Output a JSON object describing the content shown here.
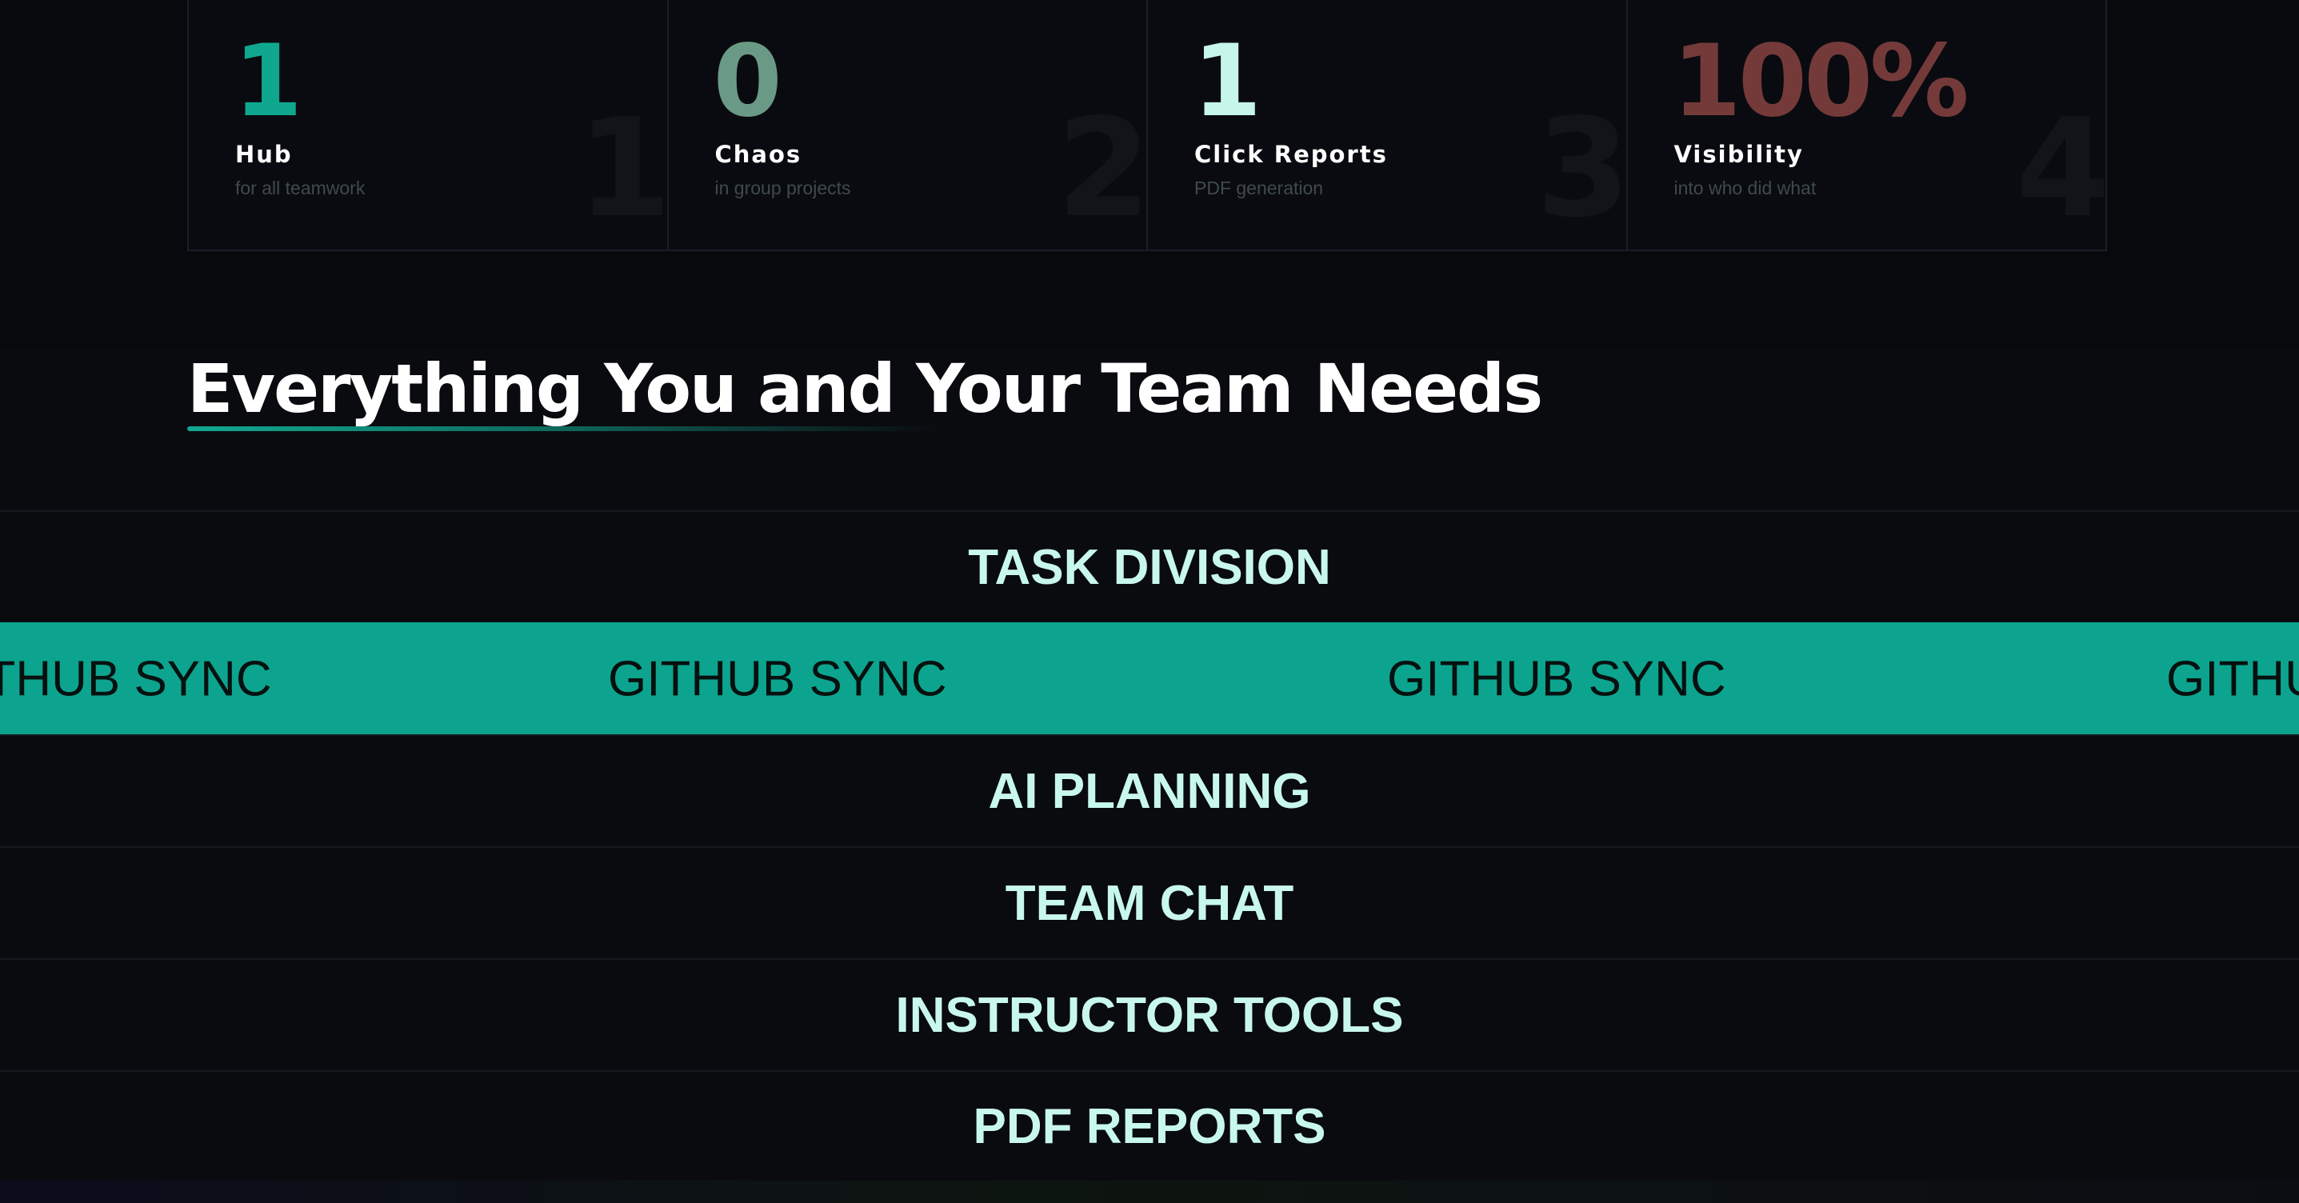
{
  "stats": [
    {
      "value": "1",
      "label": "Hub",
      "sub": "for all teamwork",
      "ghost": "1",
      "color": "#0fa88f"
    },
    {
      "value": "0",
      "label": "Chaos",
      "sub": "in group projects",
      "ghost": "2",
      "color": "#6a9a85"
    },
    {
      "value": "1",
      "label": "Click Reports",
      "sub": "PDF generation",
      "ghost": "3",
      "color": "#c6f5ea"
    },
    {
      "value": "100%",
      "label": "Visibility",
      "sub": "into who did what",
      "ghost": "4",
      "color": "#743a3a"
    }
  ],
  "features": {
    "title": "Everything You and Your Team Needs",
    "rows": [
      {
        "label": "TASK DIVISION"
      },
      {
        "label": "GITHUB SYNC",
        "marquee": true
      },
      {
        "label": "AI PLANNING"
      },
      {
        "label": "TEAM CHAT"
      },
      {
        "label": "INSTRUCTOR TOOLS"
      },
      {
        "label": "PDF REPORTS"
      }
    ],
    "marquee_items": [
      "GITHUB SYNC",
      "GITHUB SYNC",
      "GITHUB SYNC",
      "GITHUB SYNC"
    ]
  },
  "colors": {
    "accent": "#0ca48f",
    "row_text": "#c8f7ee",
    "background": "#0a0b0f"
  }
}
